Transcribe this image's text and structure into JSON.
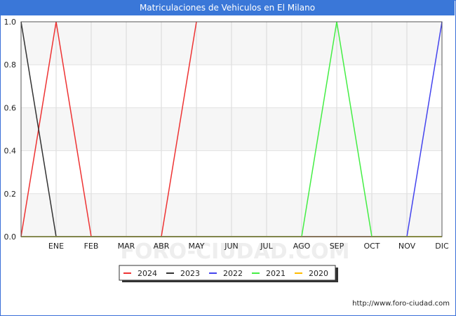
{
  "chart_data": {
    "type": "line",
    "title": "Matriculaciones de Vehiculos en El Milano",
    "xlabel": "",
    "ylabel": "",
    "x": [
      "",
      "ENE",
      "FEB",
      "MAR",
      "ABR",
      "MAY",
      "JUN",
      "JUL",
      "AGO",
      "SEP",
      "OCT",
      "NOV",
      "DIC"
    ],
    "ylim": [
      0,
      1
    ],
    "yticks": [
      "0.0",
      "0.2",
      "0.4",
      "0.6",
      "0.8",
      "1.0"
    ],
    "grid": true,
    "legend_position": "bottom",
    "watermark": "FORO-CIUDAD.COM",
    "series": [
      {
        "name": "2024",
        "color": "#ee3333",
        "values": [
          0,
          1,
          0,
          0,
          0,
          1,
          null,
          null,
          null,
          null,
          null,
          null,
          null
        ]
      },
      {
        "name": "2023",
        "color": "#333333",
        "values": [
          1,
          0,
          0,
          0,
          0,
          0,
          0,
          0,
          0,
          0,
          0,
          0,
          0
        ]
      },
      {
        "name": "2022",
        "color": "#4444ee",
        "values": [
          0,
          0,
          0,
          0,
          0,
          0,
          0,
          0,
          0,
          0,
          0,
          0,
          1
        ]
      },
      {
        "name": "2021",
        "color": "#44ee44",
        "values": [
          0,
          0,
          0,
          0,
          0,
          0,
          0,
          0,
          0,
          1,
          0,
          0,
          0
        ]
      },
      {
        "name": "2020",
        "color": "#ffbb00",
        "values": [
          0,
          0,
          0,
          0,
          0,
          0,
          0,
          0,
          0,
          0,
          0,
          0,
          0
        ]
      }
    ]
  },
  "footer": {
    "url": "http://www.foro-ciudad.com"
  }
}
